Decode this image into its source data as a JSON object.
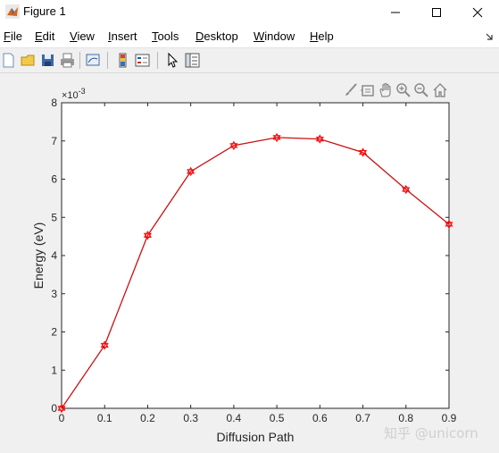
{
  "window": {
    "title": "Figure 1"
  },
  "menu": [
    {
      "pre": "",
      "u": "F",
      "post": "ile"
    },
    {
      "pre": "",
      "u": "E",
      "post": "dit"
    },
    {
      "pre": "",
      "u": "V",
      "post": "iew"
    },
    {
      "pre": "",
      "u": "I",
      "post": "nsert"
    },
    {
      "pre": "",
      "u": "T",
      "post": "ools"
    },
    {
      "pre": "",
      "u": "D",
      "post": "esktop"
    },
    {
      "pre": "",
      "u": "W",
      "post": "indow"
    },
    {
      "pre": "",
      "u": "H",
      "post": "elp"
    }
  ],
  "toolbar": {
    "icons": [
      "new-file-icon",
      "open-folder-icon",
      "save-icon",
      "print-icon",
      "link-plot-icon",
      "colorbar-icon",
      "legend-icon",
      "pointer-icon",
      "property-inspector-icon"
    ]
  },
  "axes_tools": [
    "brush-icon",
    "data-tips-icon",
    "pan-icon",
    "zoom-in-icon",
    "zoom-out-icon",
    "home-icon"
  ],
  "watermark": "知乎 @unicorn",
  "colors": {
    "line": "#cc1010",
    "marker": "#ff0000"
  },
  "chart_data": {
    "type": "line",
    "xlabel": "Diffusion Path",
    "ylabel": "Energy (eV)",
    "y_exponent_label": "×10",
    "y_exponent": "-3",
    "xlim": [
      0,
      0.9
    ],
    "ylim": [
      0,
      8
    ],
    "xticks": [
      "0",
      "0.1",
      "0.2",
      "0.3",
      "0.4",
      "0.5",
      "0.6",
      "0.7",
      "0.8",
      "0.9"
    ],
    "yticks": [
      "0",
      "1",
      "2",
      "3",
      "4",
      "5",
      "6",
      "7",
      "8"
    ],
    "grid": false,
    "series": [
      {
        "x": [
          0,
          0.1,
          0.2,
          0.3,
          0.4,
          0.5,
          0.6,
          0.7,
          0.8,
          0.9
        ],
        "y": [
          0,
          1.65,
          4.53,
          6.2,
          6.88,
          7.09,
          7.05,
          6.7,
          5.73,
          4.82
        ],
        "marker": "hexagram"
      }
    ]
  }
}
